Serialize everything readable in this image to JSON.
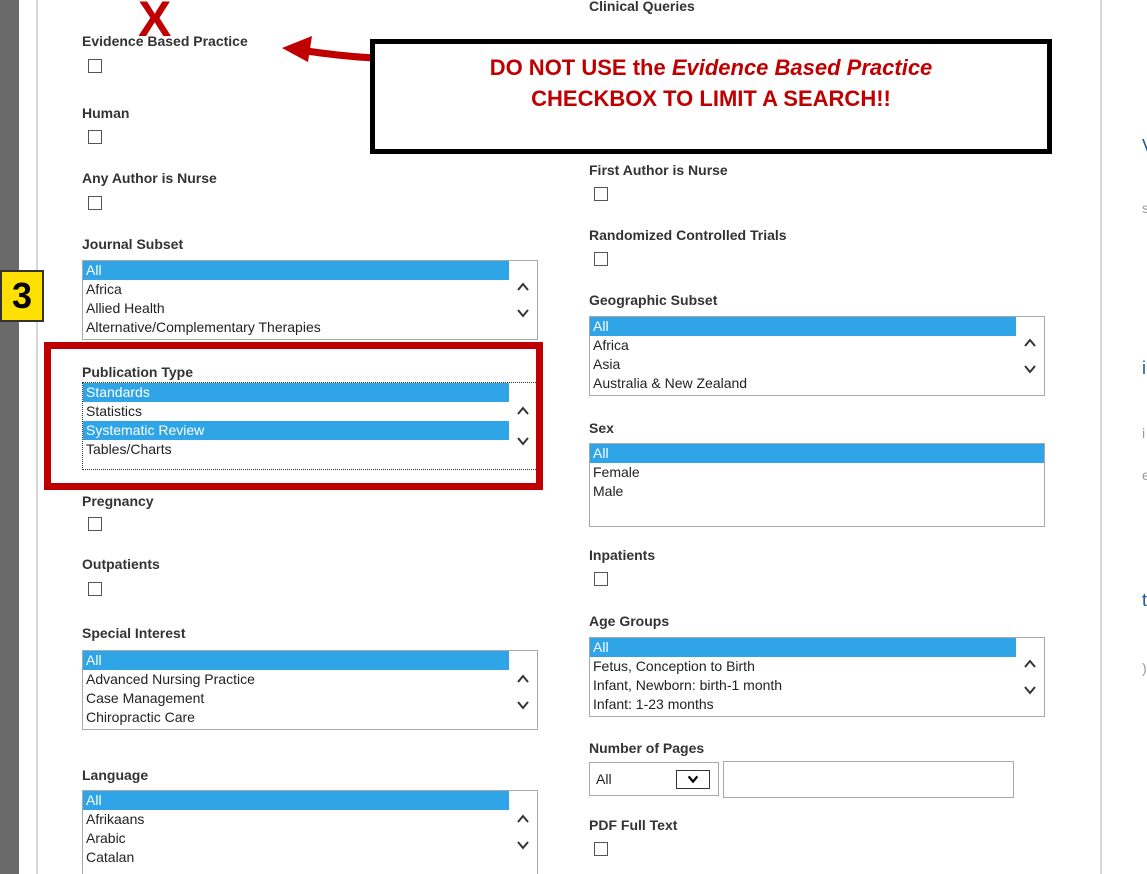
{
  "annotation": {
    "x_mark": "X",
    "line1_prefix": "DO NOT USE the ",
    "line1_italic": "Evidence Based Practice",
    "line2": "CHECKBOX TO LIMIT A SEARCH!!",
    "step_number": "3"
  },
  "left": {
    "evidence_based_practice": "Evidence Based Practice",
    "human": "Human",
    "any_author_nurse": "Any Author is Nurse",
    "journal_subset": {
      "label": "Journal Subset",
      "options": [
        "All",
        "Africa",
        "Allied Health",
        "Alternative/Complementary Therapies"
      ],
      "selected": [
        0
      ]
    },
    "publication_type": {
      "label": "Publication Type",
      "options": [
        "Standards",
        "Statistics",
        "Systematic Review",
        "Tables/Charts"
      ],
      "selected": [
        0,
        2
      ]
    },
    "pregnancy": "Pregnancy",
    "outpatients": "Outpatients",
    "special_interest": {
      "label": "Special Interest",
      "options": [
        "All",
        "Advanced Nursing Practice",
        "Case Management",
        "Chiropractic Care"
      ],
      "selected": [
        0
      ]
    },
    "language": {
      "label": "Language",
      "options": [
        "All",
        "Afrikaans",
        "Arabic",
        "Catalan"
      ],
      "selected": [
        0
      ]
    }
  },
  "right": {
    "clinical_queries": "Clinical Queries",
    "first_author_nurse": "First Author is Nurse",
    "randomized_controlled_trials": "Randomized Controlled Trials",
    "geographic_subset": {
      "label": "Geographic Subset",
      "options": [
        "All",
        "Africa",
        "Asia",
        "Australia & New Zealand"
      ],
      "selected": [
        0
      ]
    },
    "sex": {
      "label": "Sex",
      "options": [
        "All",
        "Female",
        "Male"
      ],
      "selected": [
        0
      ]
    },
    "inpatients": "Inpatients",
    "age_groups": {
      "label": "Age Groups",
      "options": [
        "All",
        "Fetus, Conception to Birth",
        "Infant, Newborn: birth-1 month",
        "Infant: 1-23 months"
      ],
      "selected": [
        0
      ]
    },
    "number_of_pages": {
      "label": "Number of Pages",
      "select_value": "All"
    },
    "pdf_full_text": "PDF Full Text"
  },
  "colors": {
    "selected_option": "#2fa4e7",
    "annotation_red": "#c00000",
    "badge_yellow": "#ffe000"
  }
}
